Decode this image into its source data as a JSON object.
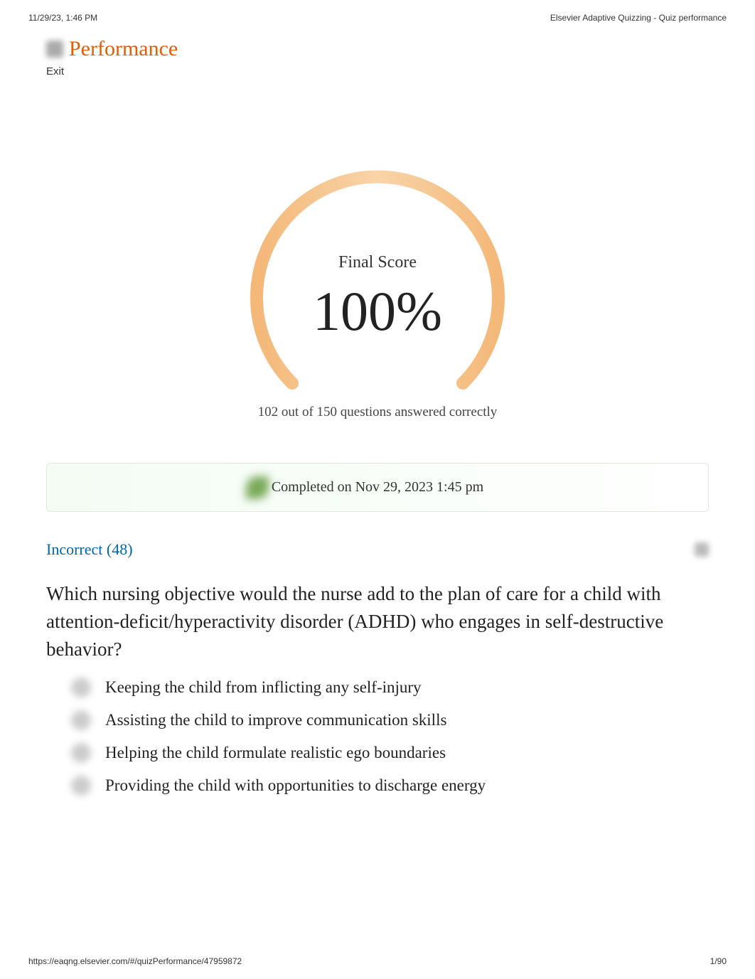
{
  "print_header": {
    "datetime": "11/29/23, 1:46 PM",
    "title": "Elsevier Adaptive Quizzing - Quiz performance"
  },
  "header": {
    "title": "Performance",
    "exit_label": "Exit"
  },
  "score": {
    "label": "Final Score",
    "value": "100%",
    "summary": "102 out of 150 questions answered correctly"
  },
  "completion": {
    "text": "Completed on Nov 29, 2023 1:45 pm"
  },
  "incorrect": {
    "label": "Incorrect (48)"
  },
  "question": {
    "text": "Which nursing objective would the nurse add to the plan of care for a child with attention-deficit/hyperactivity disorder (ADHD) who engages in self-destructive behavior?",
    "answers": [
      "Keeping the child from inflicting any self-injury",
      "Assisting the child to improve communication skills",
      "Helping the child formulate realistic ego boundaries",
      "Providing the child with opportunities to discharge energy"
    ]
  },
  "print_footer": {
    "url": "https://eaqng.elsevier.com/#/quizPerformance/47959872",
    "page": "1/90"
  }
}
